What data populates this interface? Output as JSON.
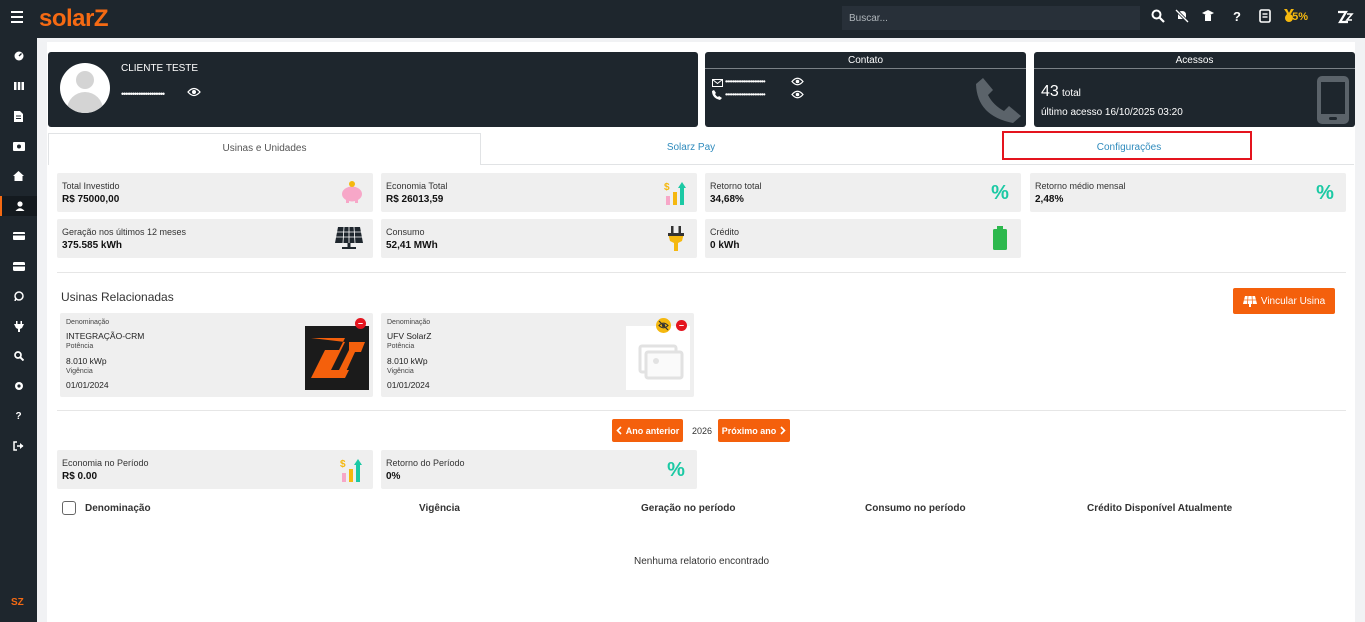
{
  "app": {
    "logo": "solarZ"
  },
  "topbar": {
    "search_placeholder": "Buscar...",
    "progress_label": "55%",
    "icons": [
      "search-icon",
      "notifications-off-icon",
      "graduation-cap-icon",
      "help-icon",
      "checklist-icon",
      "medal-icon",
      "solarz-logo-icon"
    ]
  },
  "sidebar": {
    "items": [
      "dashboard-icon",
      "columns-icon",
      "document-icon",
      "money-icon",
      "home-icon",
      "user-icon",
      "card-icon",
      "wallet-icon",
      "whatsapp-icon",
      "plug-icon",
      "search-icon",
      "settings-icon",
      "help-icon",
      "logout-icon"
    ],
    "active_index": 5,
    "footer_logo": "SZ"
  },
  "client": {
    "name": "CLIENTE TESTE",
    "masked_value": "••••••••••••••••••••"
  },
  "contato": {
    "title": "Contato",
    "email_masked": "••••••••••••••••••••••",
    "phone_masked": "••••••••••••••••••••••"
  },
  "acessos": {
    "title": "Acessos",
    "count": "43",
    "count_label": "total",
    "last_access": "último acesso 16/10/2025 03:20"
  },
  "tabs": [
    {
      "label": "Usinas e Unidades"
    },
    {
      "label": "Solarz Pay"
    },
    {
      "label": "Configurações"
    }
  ],
  "stats": [
    {
      "label": "Total Investido",
      "value": "R$ 75000,00",
      "icon": "piggy-bank-icon"
    },
    {
      "label": "Economia Total",
      "value": "R$ 26013,59",
      "icon": "money-growth-icon"
    },
    {
      "label": "Retorno total",
      "value": "34,68%",
      "icon": "percent-icon"
    },
    {
      "label": "Retorno médio mensal",
      "value": "2,48%",
      "icon": "percent-icon"
    },
    {
      "label": "Geração nos últimos 12 meses",
      "value": "375.585 kWh",
      "icon": "solar-panel-icon"
    },
    {
      "label": "Consumo",
      "value": "52,41 MWh",
      "icon": "plug-icon"
    },
    {
      "label": "Crédito",
      "value": "0 kWh",
      "icon": "battery-icon"
    }
  ],
  "usinas": {
    "title": "Usinas Relacionadas",
    "link_button": "Vincular Usina",
    "items": [
      {
        "den_label": "Denominação",
        "den": "INTEGRAÇÃO-CRM",
        "pot_label": "Potência",
        "pot": "8.010 kWp",
        "vig_label": "Vigência",
        "vig": "01/01/2024"
      },
      {
        "den_label": "Denominação",
        "den": "UFV SolarZ",
        "pot_label": "Potência",
        "pot": "8.010 kWp",
        "vig_label": "Vigência",
        "vig": "01/01/2024"
      }
    ]
  },
  "period": {
    "prev_button": "Ano anterior",
    "year": "2026",
    "next_button": "Próximo ano",
    "stats": [
      {
        "label": "Economia no Período",
        "value": "R$ 0.00",
        "icon": "money-growth-icon"
      },
      {
        "label": "Retorno do Período",
        "value": "0%",
        "icon": "percent-icon"
      }
    ]
  },
  "table": {
    "headers": [
      "Denominação",
      "Vigência",
      "Geração no período",
      "Consumo no período",
      "Crédito Disponível Atualmente"
    ],
    "empty_message": "Nenhuma relatorio encontrado"
  },
  "colors": {
    "brand": "#f4600c",
    "dark": "#1e262d",
    "teal": "#1bc9a4",
    "link": "#2f8bbd",
    "highlight": "#e4141e"
  }
}
